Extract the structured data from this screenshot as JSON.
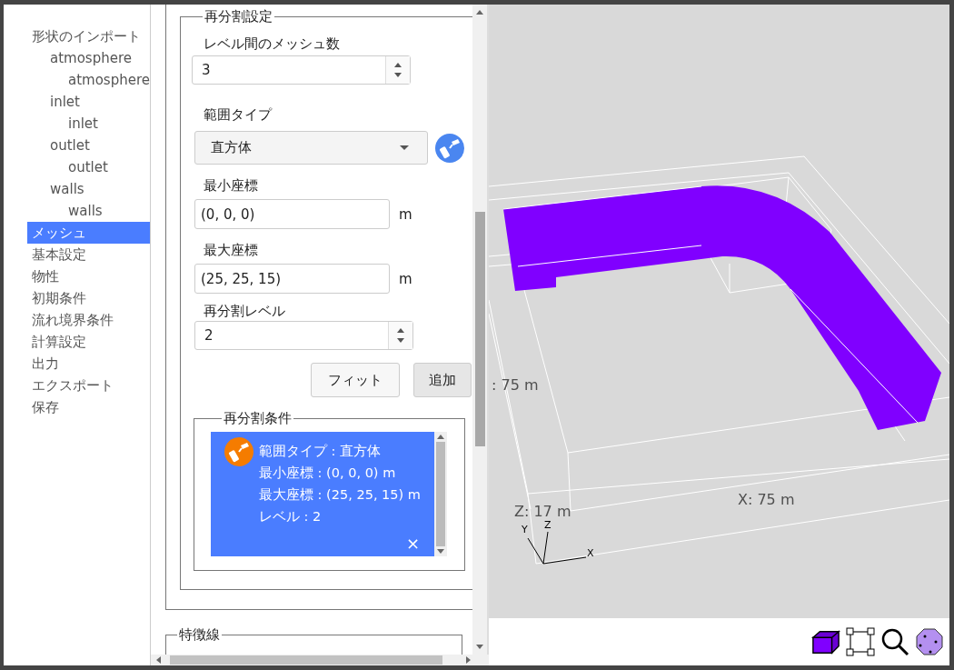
{
  "sidebar": {
    "items": [
      {
        "label": "形状のインポート",
        "selected": false,
        "children": [
          {
            "label": "atmosphere",
            "selected": false,
            "children": [
              {
                "label": "atmosphere",
                "selected": false
              }
            ]
          },
          {
            "label": "inlet",
            "selected": false,
            "children": [
              {
                "label": "inlet",
                "selected": false
              }
            ]
          },
          {
            "label": "outlet",
            "selected": false,
            "children": [
              {
                "label": "outlet",
                "selected": false
              }
            ]
          },
          {
            "label": "walls",
            "selected": false,
            "children": [
              {
                "label": "walls",
                "selected": false
              }
            ]
          }
        ]
      },
      {
        "label": "メッシュ",
        "selected": true
      },
      {
        "label": "基本設定",
        "selected": false
      },
      {
        "label": "物性",
        "selected": false
      },
      {
        "label": "初期条件",
        "selected": false
      },
      {
        "label": "流れ境界条件",
        "selected": false
      },
      {
        "label": "計算設定",
        "selected": false
      },
      {
        "label": "出力",
        "selected": false
      },
      {
        "label": "エクスポート",
        "selected": false
      },
      {
        "label": "保存",
        "selected": false
      }
    ]
  },
  "refinement_settings": {
    "legend": "再分割設定",
    "mesh_between_levels": {
      "label": "レベル間のメッシュ数",
      "value": "3"
    },
    "region_type": {
      "label": "範囲タイプ",
      "value": "直方体"
    },
    "min_coord": {
      "label": "最小座標",
      "value": "(0, 0, 0)",
      "unit": "m"
    },
    "max_coord": {
      "label": "最大座標",
      "value": "(25, 25, 15)",
      "unit": "m"
    },
    "refine_level": {
      "label": "再分割レベル",
      "value": "2"
    },
    "buttons": [
      "フィット",
      "追加"
    ],
    "conditions": {
      "legend": "再分割条件",
      "items": [
        {
          "selected": true,
          "lines": [
            "範囲タイプ : 直方体",
            "最小座標 : (0, 0, 0) m",
            "最大座標 : (25, 25, 15) m",
            "レベル : 2"
          ],
          "remove": "×"
        }
      ]
    }
  },
  "feature_lines": {
    "legend": "特徴線"
  },
  "viewer": {
    "labels": [
      {
        "kind": "y",
        "text": ": 75 m"
      },
      {
        "kind": "z",
        "text": "Z: 17 m"
      },
      {
        "kind": "x",
        "text": "X: 75 m"
      }
    ],
    "axes": [
      "Y",
      "Z",
      "X"
    ]
  }
}
